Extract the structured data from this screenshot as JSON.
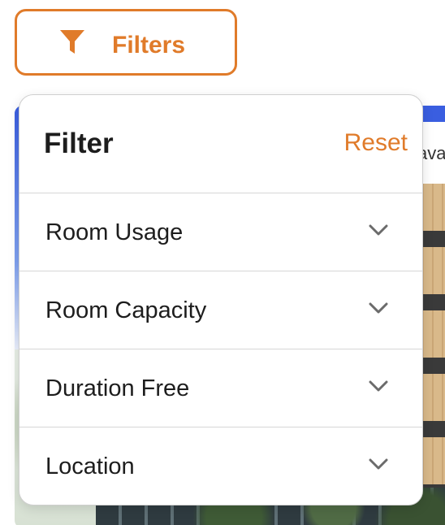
{
  "filters_button": {
    "label": "Filters",
    "icon": "funnel-icon"
  },
  "background": {
    "partial_text": "ava"
  },
  "panel": {
    "title": "Filter",
    "reset_label": "Reset",
    "rows": [
      {
        "label": "Room Usage",
        "icon": "chevron-down-icon"
      },
      {
        "label": "Room Capacity",
        "icon": "chevron-down-icon"
      },
      {
        "label": "Duration Free",
        "icon": "chevron-down-icon"
      },
      {
        "label": "Location",
        "icon": "chevron-down-icon"
      }
    ]
  },
  "colors": {
    "accent": "#e07b2a",
    "text": "#1d1d1d",
    "divider": "#d6d6d6",
    "blue": "#3a5ee0"
  }
}
